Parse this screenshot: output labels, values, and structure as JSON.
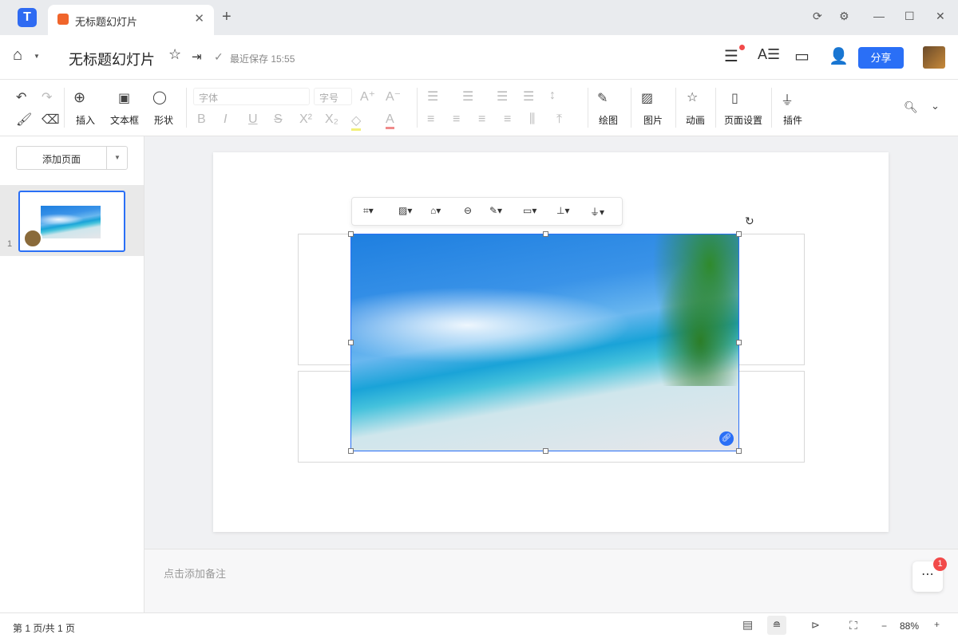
{
  "app": {
    "tab_title": "无标题幻灯片",
    "doc_title": "无标题幻灯片",
    "save_status": "最近保存 15:55",
    "share": "分享"
  },
  "toolbar": {
    "insert": "插入",
    "textbox": "文本框",
    "shape": "形状",
    "font_placeholder": "字体",
    "size_placeholder": "字号",
    "draw": "绘图",
    "picture": "图片",
    "animation": "动画",
    "page_setup": "页面设置",
    "plugin": "插件"
  },
  "sidebar": {
    "add_page": "添加页面",
    "slide_number": "1"
  },
  "notes": {
    "placeholder": "点击添加备注"
  },
  "fab": {
    "badge": "1"
  },
  "status": {
    "page": "第 1 页/共 1 页",
    "zoom": "88%"
  },
  "colors": {
    "accent": "#2a6ff6",
    "badge": "#f24a4a"
  }
}
